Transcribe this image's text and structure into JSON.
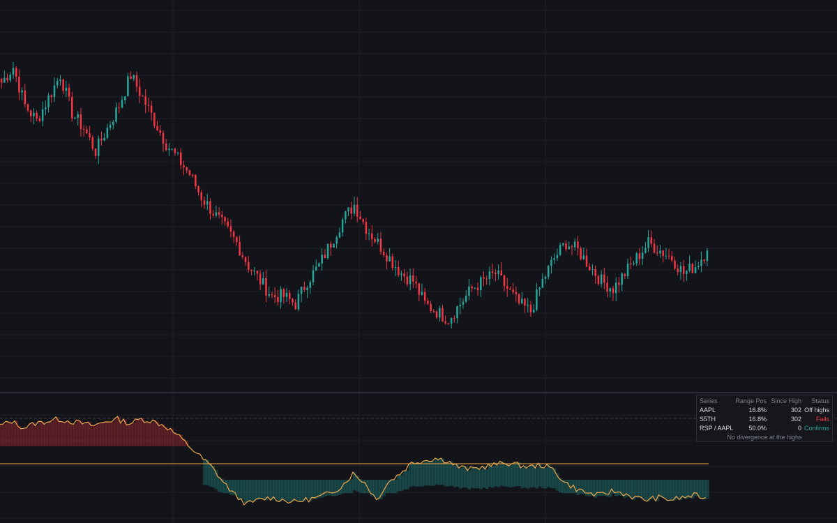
{
  "colors": {
    "background": "#131419",
    "grid": "#1f2128",
    "up": "#26a69a",
    "down": "#f23645",
    "osc_line": "#f0a94b",
    "pane_separator": "#2a2d35"
  },
  "chart_data": [
    {
      "type": "candlestick",
      "title": "",
      "grid": true,
      "trend_closes": [
        231,
        233,
        228,
        226,
        229,
        232,
        227,
        225,
        222,
        225,
        228,
        232,
        229,
        226,
        223,
        221,
        219,
        216,
        214,
        212,
        210,
        207,
        205,
        203,
        203,
        202,
        205,
        207,
        210,
        213,
        215,
        212,
        210,
        208,
        206,
        205,
        202,
        201,
        200,
        202,
        204,
        205,
        206,
        204,
        202,
        201,
        205,
        208,
        210,
        209,
        207,
        205,
        204,
        206,
        208,
        210,
        209,
        208,
        206,
        207,
        209
      ],
      "points_per_segment": 4,
      "noise_scale": 0.85,
      "osc_closes": [
        64,
        66,
        63,
        65,
        66,
        67,
        66,
        65,
        64,
        66,
        67,
        65,
        67,
        66,
        64,
        60,
        55,
        50,
        45,
        38,
        32,
        28,
        30,
        31,
        30,
        29,
        30,
        31,
        33,
        36,
        42,
        38,
        30,
        38,
        42,
        47,
        48,
        49,
        48,
        45,
        44,
        45,
        46,
        47,
        46,
        45,
        46,
        44,
        38,
        35,
        33,
        32,
        34,
        33,
        31,
        30,
        31,
        30,
        31,
        32,
        31
      ],
      "osc_reference": 50
    }
  ],
  "stats": {
    "header": {
      "series": "Series",
      "range_pos": "Range Pos",
      "since_high": "Since High",
      "status": "Status"
    },
    "rows": [
      {
        "series": "AAPL",
        "range_pos": "16.8%",
        "since_high": "302",
        "status": "Off highs",
        "status_kind": "off"
      },
      {
        "series": "S5TH",
        "range_pos": "16.8%",
        "since_high": "302",
        "status": "Fails",
        "status_kind": "fail"
      },
      {
        "series": "RSP / AAPL",
        "range_pos": "50.0%",
        "since_high": "0",
        "status": "Confirms",
        "status_kind": "conf"
      }
    ],
    "note": "No divergence at the highs"
  }
}
